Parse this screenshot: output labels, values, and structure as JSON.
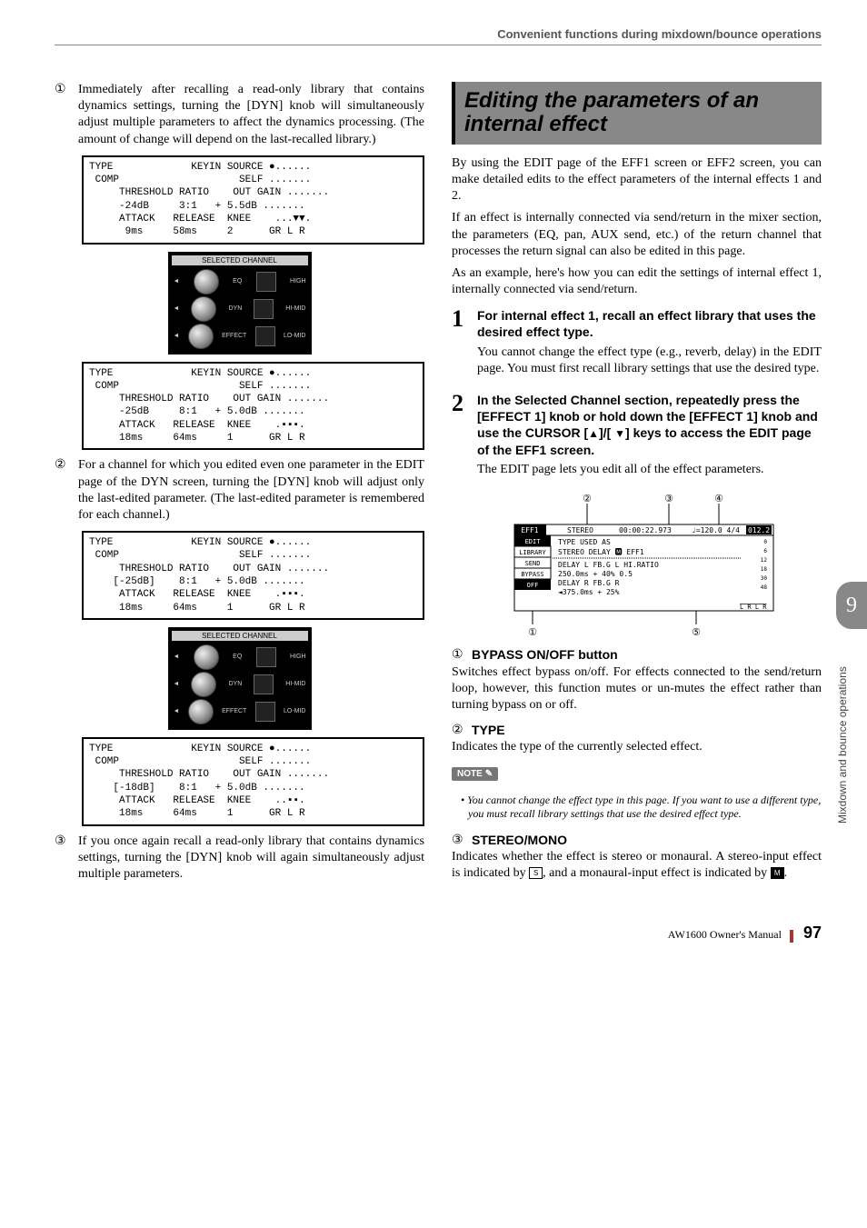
{
  "header": "Convenient functions during mixdown/bounce operations",
  "left_column": {
    "para1_num": "①",
    "para1": "Immediately after recalling a read-only library that contains dynamics settings, turning the [DYN] knob will simultaneously adjust multiple parameters to affect the dynamics processing. (The amount of change will depend on the last-recalled library.)",
    "fig1": "TYPE             KEYIN SOURCE ●......\n COMP                    SELF .......\n     THRESHOLD RATIO    OUT GAIN .......\n     -24dB     3:1   + 5.5dB .......\n     ATTACK   RELEASE  KNEE    ...▼▼.\n      9ms     58ms     2      GR L R",
    "knob_panel_title": "SELECTED CHANNEL",
    "knob_eq": "EQ",
    "knob_high": "HIGH",
    "knob_himid": "HI-MID",
    "knob_dyn": "DYN",
    "knob_lomid": "LO-MID",
    "knob_effect": "EFFECT",
    "fig2": "TYPE             KEYIN SOURCE ●......\n COMP                    SELF .......\n     THRESHOLD RATIO    OUT GAIN .......\n     -25dB     8:1   + 5.0dB .......\n     ATTACK   RELEASE  KNEE    .▪▪▪.\n     18ms     64ms     1      GR L R",
    "para2_num": "②",
    "para2": "For a channel for which you edited even one parameter in the EDIT page of the DYN screen, turning the [DYN] knob will adjust only the last-edited parameter. (The last-edited parameter is remembered for each channel.)",
    "fig3": "TYPE             KEYIN SOURCE ●......\n COMP                    SELF .......\n     THRESHOLD RATIO    OUT GAIN .......\n    [-25dB]    8:1   + 5.0dB .......\n     ATTACK   RELEASE  KNEE    .▪▪▪.\n     18ms     64ms     1      GR L R",
    "fig4": "TYPE             KEYIN SOURCE ●......\n COMP                    SELF .......\n     THRESHOLD RATIO    OUT GAIN .......\n    [-18dB]    8:1   + 5.0dB .......\n     ATTACK   RELEASE  KNEE    ..▪▪.\n     18ms     64ms     1      GR L R",
    "para3_num": "③",
    "para3": "If you once again recall a read-only library that contains dynamics settings, turning the [DYN] knob will again simultaneously adjust multiple parameters."
  },
  "right_column": {
    "heading": "Editing the parameters of an internal effect",
    "intro1": "By using the EDIT page of the EFF1 screen or EFF2 screen, you can make detailed edits to the effect parameters of the internal effects 1 and 2.",
    "intro2": "If an effect is internally connected via send/return in the mixer section, the parameters (EQ, pan, AUX send, etc.) of the return channel that processes the return signal can also be edited in this page.",
    "intro3": "As an example, here's how you can edit the settings of internal effect 1, internally connected via send/return.",
    "step1_num": "1",
    "step1_head": "For internal effect 1, recall an effect library that uses the desired effect type.",
    "step1_body": "You cannot change the effect type (e.g., reverb, delay) in the EDIT page. You must first recall library settings that use the desired type.",
    "step2_num": "2",
    "step2_head_a": "In the Selected Channel section, repeatedly press the [EFFECT 1] knob or hold down the [EFFECT 1] knob and use the CURSOR [",
    "step2_head_b": "]/[ ",
    "step2_head_c": "] keys to access the EDIT page of the EFF1 screen.",
    "step2_body": "The EDIT page lets you edit all of the effect parameters.",
    "screen_text": {
      "title": "EFF1",
      "stereo": "STEREO",
      "time": "00:00:22.973",
      "tempo": "♩=120.0 4/4",
      "measure": "012.2",
      "tabs": [
        "EDIT",
        "LIBRARY",
        "SEND",
        "BYPASS",
        "OFF"
      ],
      "line1": "TYPE           USED AS",
      "line2": "STEREO DELAY 🅼   EFF1",
      "line3": "DELAY L   FB.G L       HI.RATIO",
      "line4": " 250.0ms +    40%        0.5",
      "line5": "DELAY R   FB.G R",
      "line6": "◄375.0ms +    25%",
      "scale": "0 6 12 18 30 48",
      "lr": "L R  L R"
    },
    "callouts": {
      "c2": "②",
      "c3": "③",
      "c4": "④",
      "c1": "①",
      "c5": "⑤"
    },
    "b1_num": "①",
    "b1_head": "BYPASS ON/OFF button",
    "b1_body": "Switches effect bypass on/off. For effects connected to the send/return loop, however, this function mutes or un-mutes the effect rather than turning bypass on or off.",
    "b2_num": "②",
    "b2_head": "TYPE",
    "b2_body": "Indicates the type of the currently selected effect.",
    "note_tag": "NOTE",
    "note_body": "You cannot change the effect type in this page. If you want to use a different type, you must recall library settings that use the desired effect type.",
    "b3_num": "③",
    "b3_head": "STEREO/MONO",
    "b3_body_a": "Indicates whether the effect is stereo or monaural. A stereo-input effect is indicated by ",
    "b3_body_b": ", and a monaural-input effect is indicated by ",
    "b3_body_c": ".",
    "icon_s": "S",
    "icon_m": "M"
  },
  "side_tab": {
    "num": "9",
    "label": "Mixdown and bounce operations"
  },
  "footer": {
    "manual": "AW1600  Owner's Manual",
    "page": "97"
  }
}
